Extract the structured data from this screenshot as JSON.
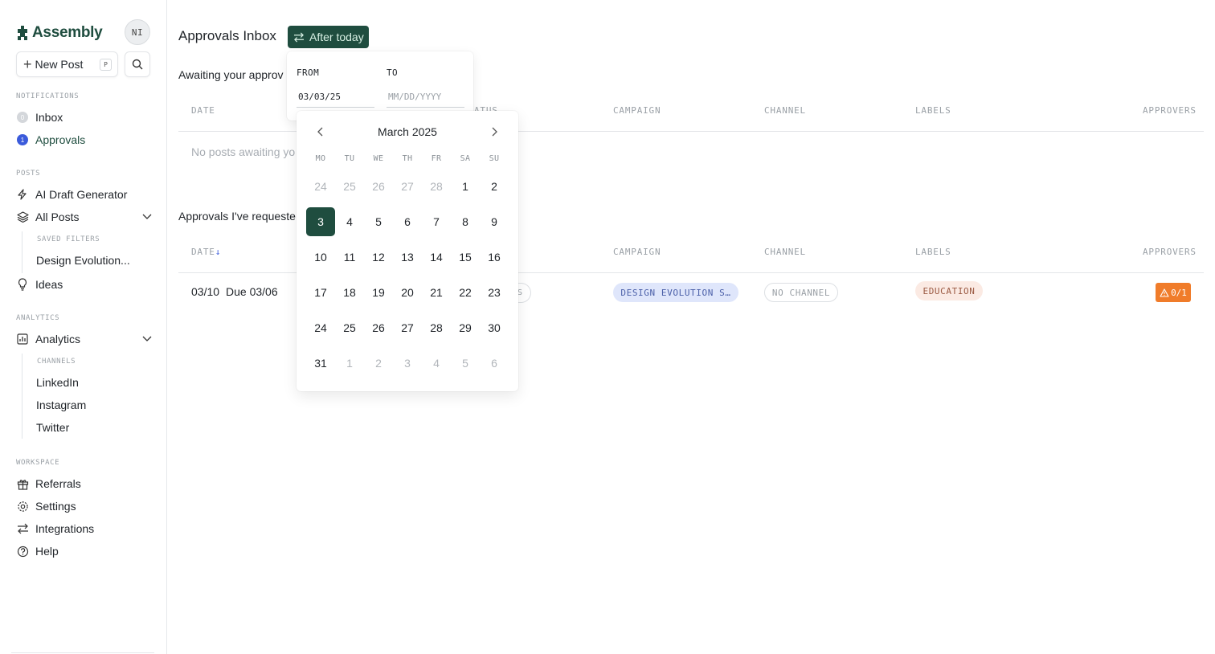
{
  "sidebar": {
    "logo_text": "Assembly",
    "avatar_initials": "NI",
    "new_post_label": "New Post",
    "new_post_shortcut": "P",
    "notifications_label": "NOTIFICATIONS",
    "inbox": {
      "label": "Inbox",
      "count": "0"
    },
    "approvals": {
      "label": "Approvals",
      "count": "1"
    },
    "posts_label": "POSTS",
    "ai_draft_label": "AI Draft Generator",
    "all_posts_label": "All Posts",
    "saved_filters_label": "SAVED FILTERS",
    "saved_filter_item": "Design Evolution...",
    "ideas_label": "Ideas",
    "analytics_section_label": "ANALYTICS",
    "analytics_label": "Analytics",
    "channels_label": "CHANNELS",
    "channels": [
      "LinkedIn",
      "Instagram",
      "Twitter"
    ],
    "workspace_label": "WORKSPACE",
    "referrals_label": "Referrals",
    "settings_label": "Settings",
    "integrations_label": "Integrations",
    "help_label": "Help"
  },
  "main": {
    "title": "Approvals Inbox",
    "filter_label": "After today",
    "awaiting_title": "Awaiting your approv",
    "awaiting_columns": {
      "date": "DATE",
      "status": "ATUS",
      "campaign": "CAMPAIGN",
      "channel": "CHANNEL",
      "labels": "LABELS",
      "approvers": "APPROVERS"
    },
    "awaiting_empty": "No posts awaiting yo",
    "requested_title": "Approvals I've requeste",
    "requested_columns": {
      "date": "DATE",
      "sort_arrow": "↓",
      "campaign": "CAMPAIGN",
      "channel": "CHANNEL",
      "labels": "LABELS",
      "approvers": "APPROVERS"
    },
    "row": {
      "date": "03/10",
      "due": "Due 03/06",
      "status_fragment": "S",
      "campaign": "DESIGN EVOLUTION S…",
      "channel": "NO CHANNEL",
      "label": "EDUCATION",
      "approvers": "0/1"
    }
  },
  "range": {
    "from_label": "FROM",
    "to_label": "TO",
    "from_value": "03/03/25",
    "to_placeholder": "MM/DD/YYYY"
  },
  "calendar": {
    "month_title": "March 2025",
    "weekdays": [
      "MO",
      "TU",
      "WE",
      "TH",
      "FR",
      "SA",
      "SU"
    ],
    "selected_day": "3",
    "days": [
      {
        "d": "24",
        "m": true
      },
      {
        "d": "25",
        "m": true
      },
      {
        "d": "26",
        "m": true
      },
      {
        "d": "27",
        "m": true
      },
      {
        "d": "28",
        "m": true
      },
      {
        "d": "1",
        "m": false
      },
      {
        "d": "2",
        "m": false
      },
      {
        "d": "3",
        "m": false,
        "s": true
      },
      {
        "d": "4",
        "m": false
      },
      {
        "d": "5",
        "m": false
      },
      {
        "d": "6",
        "m": false
      },
      {
        "d": "7",
        "m": false
      },
      {
        "d": "8",
        "m": false
      },
      {
        "d": "9",
        "m": false
      },
      {
        "d": "10",
        "m": false
      },
      {
        "d": "11",
        "m": false
      },
      {
        "d": "12",
        "m": false
      },
      {
        "d": "13",
        "m": false
      },
      {
        "d": "14",
        "m": false
      },
      {
        "d": "15",
        "m": false
      },
      {
        "d": "16",
        "m": false
      },
      {
        "d": "17",
        "m": false
      },
      {
        "d": "18",
        "m": false
      },
      {
        "d": "19",
        "m": false
      },
      {
        "d": "20",
        "m": false
      },
      {
        "d": "21",
        "m": false
      },
      {
        "d": "22",
        "m": false
      },
      {
        "d": "23",
        "m": false
      },
      {
        "d": "24",
        "m": false
      },
      {
        "d": "25",
        "m": false
      },
      {
        "d": "26",
        "m": false
      },
      {
        "d": "27",
        "m": false
      },
      {
        "d": "28",
        "m": false
      },
      {
        "d": "29",
        "m": false
      },
      {
        "d": "30",
        "m": false
      },
      {
        "d": "31",
        "m": false
      },
      {
        "d": "1",
        "m": true
      },
      {
        "d": "2",
        "m": true
      },
      {
        "d": "3",
        "m": true
      },
      {
        "d": "4",
        "m": true
      },
      {
        "d": "5",
        "m": true
      },
      {
        "d": "6",
        "m": true
      }
    ]
  },
  "colors": {
    "brand": "#1f4d3f",
    "accent_blue": "#3b5bdb",
    "warning": "#f07c2a"
  }
}
